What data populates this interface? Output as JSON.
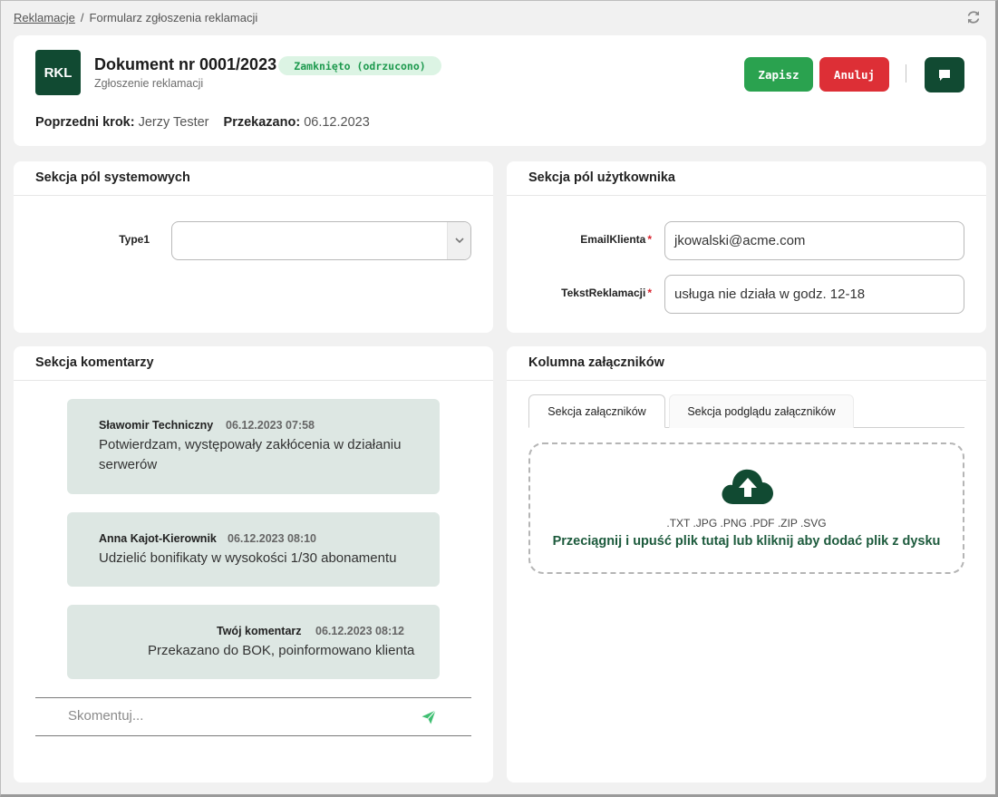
{
  "breadcrumb": {
    "root": "Reklamacje",
    "separator": "/",
    "current": "Formularz zgłoszenia reklamacji"
  },
  "header": {
    "logo_text": "RKL",
    "title": "Dokument nr 0001/2023",
    "status": "Zamknięto (odrzucono)",
    "subtitle": "Zgłoszenie reklamacji",
    "save_label": "Zapisz",
    "cancel_label": "Anuluj",
    "prev_step_label": "Poprzedni krok:",
    "prev_step_value": "Jerzy Tester",
    "handed_label": "Przekazano:",
    "handed_value": "06.12.2023"
  },
  "system_section": {
    "title": "Sekcja pól systemowych",
    "fields": [
      {
        "label": "Type1",
        "value": ""
      }
    ]
  },
  "user_section": {
    "title": "Sekcja pól użytkownika",
    "fields": [
      {
        "label": "EmailKlienta",
        "required": "*",
        "value": "jkowalski@acme.com"
      },
      {
        "label": "TekstReklamacji",
        "required": "*",
        "value": "usługa nie działa w godz. 12-18"
      }
    ]
  },
  "comments_section": {
    "title": "Sekcja komentarzy",
    "comments": [
      {
        "author": "Sławomir Techniczny",
        "time": "06.12.2023 07:58",
        "text_line1": "Potwierdzam, występowały zakłócenia w działaniu",
        "text_line2": "serwerów"
      },
      {
        "author": "Anna Kajot-Kierownik",
        "time": "06.12.2023 08:10",
        "text_line1": "Udzielić bonifikaty w wysokości 1/30 abonamentu"
      },
      {
        "author": "Twój komentarz",
        "time": "06.12.2023 08:12",
        "text_line1": "Przekazano do BOK, poinformowano klienta"
      }
    ],
    "input_placeholder": "Skomentuj..."
  },
  "attachments_section": {
    "title": "Kolumna załączników",
    "tabs": [
      {
        "label": "Sekcja załączników",
        "active": true
      },
      {
        "label": "Sekcja podglądu załączników",
        "active": false
      }
    ],
    "extensions": ".TXT .JPG .PNG .PDF .ZIP .SVG",
    "drop_text": "Przeciągnij i upuść plik tutaj lub kliknij aby dodać plik z dysku"
  },
  "colors": {
    "brand_dark_green": "#114a32",
    "save_green": "#2aa24f",
    "cancel_red": "#dd2f36",
    "status_bg": "#dcf4e4",
    "status_text": "#1e9a4f",
    "comment_bg": "#dde7e3",
    "send_icon": "#3fbf72"
  },
  "icons": {
    "refresh": "refresh-icon",
    "chat": "chat-bubble-icon",
    "select_arrow": "chevron-down-icon",
    "send": "send-icon",
    "upload": "cloud-upload-icon"
  }
}
